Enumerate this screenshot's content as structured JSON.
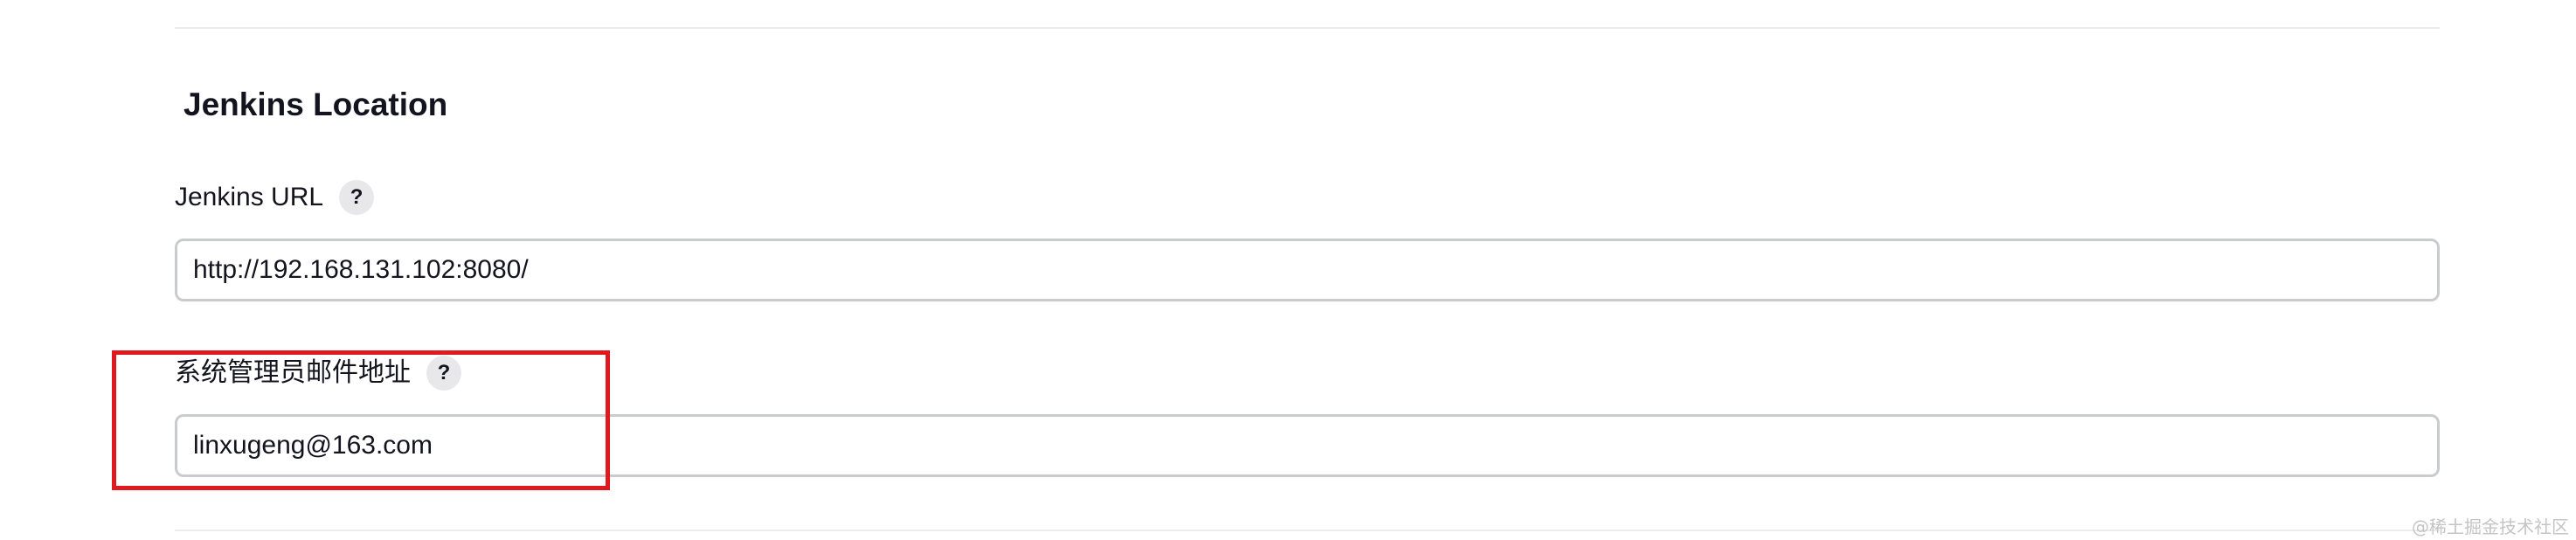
{
  "section": {
    "title": "Jenkins Location"
  },
  "jenkins_url": {
    "label": "Jenkins URL",
    "help": "?",
    "value": "http://192.168.131.102:8080/"
  },
  "admin_email": {
    "label": "系统管理员邮件地址",
    "help": "?",
    "value": "linxugeng@163.com"
  },
  "watermark": "@稀土掘金技术社区",
  "colors": {
    "highlight": "#e0191e",
    "input_border": "#c9cbcf",
    "help_bg": "#e8e8ea"
  },
  "icons": {
    "help": "question-mark-icon"
  }
}
